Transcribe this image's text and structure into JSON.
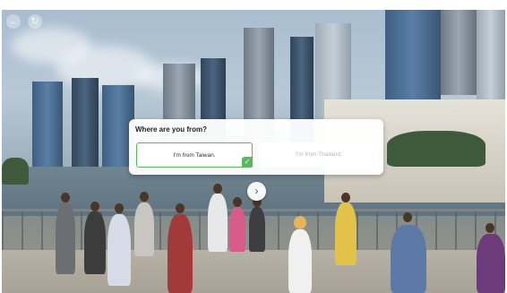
{
  "nav": {
    "back_icon": "circle-arrow-icon",
    "reset_icon": "reset-icon"
  },
  "dialog": {
    "question": "Where are you from?",
    "options": [
      {
        "label": "I'm from Taiwan.",
        "selected": true
      },
      {
        "label": "I'm from Thailand.",
        "selected": false
      }
    ]
  },
  "next_button": {
    "icon": "chevron-right-icon"
  },
  "colors": {
    "selected_accent": "#5cb85c",
    "unselected_text": "#b7b7b7"
  }
}
